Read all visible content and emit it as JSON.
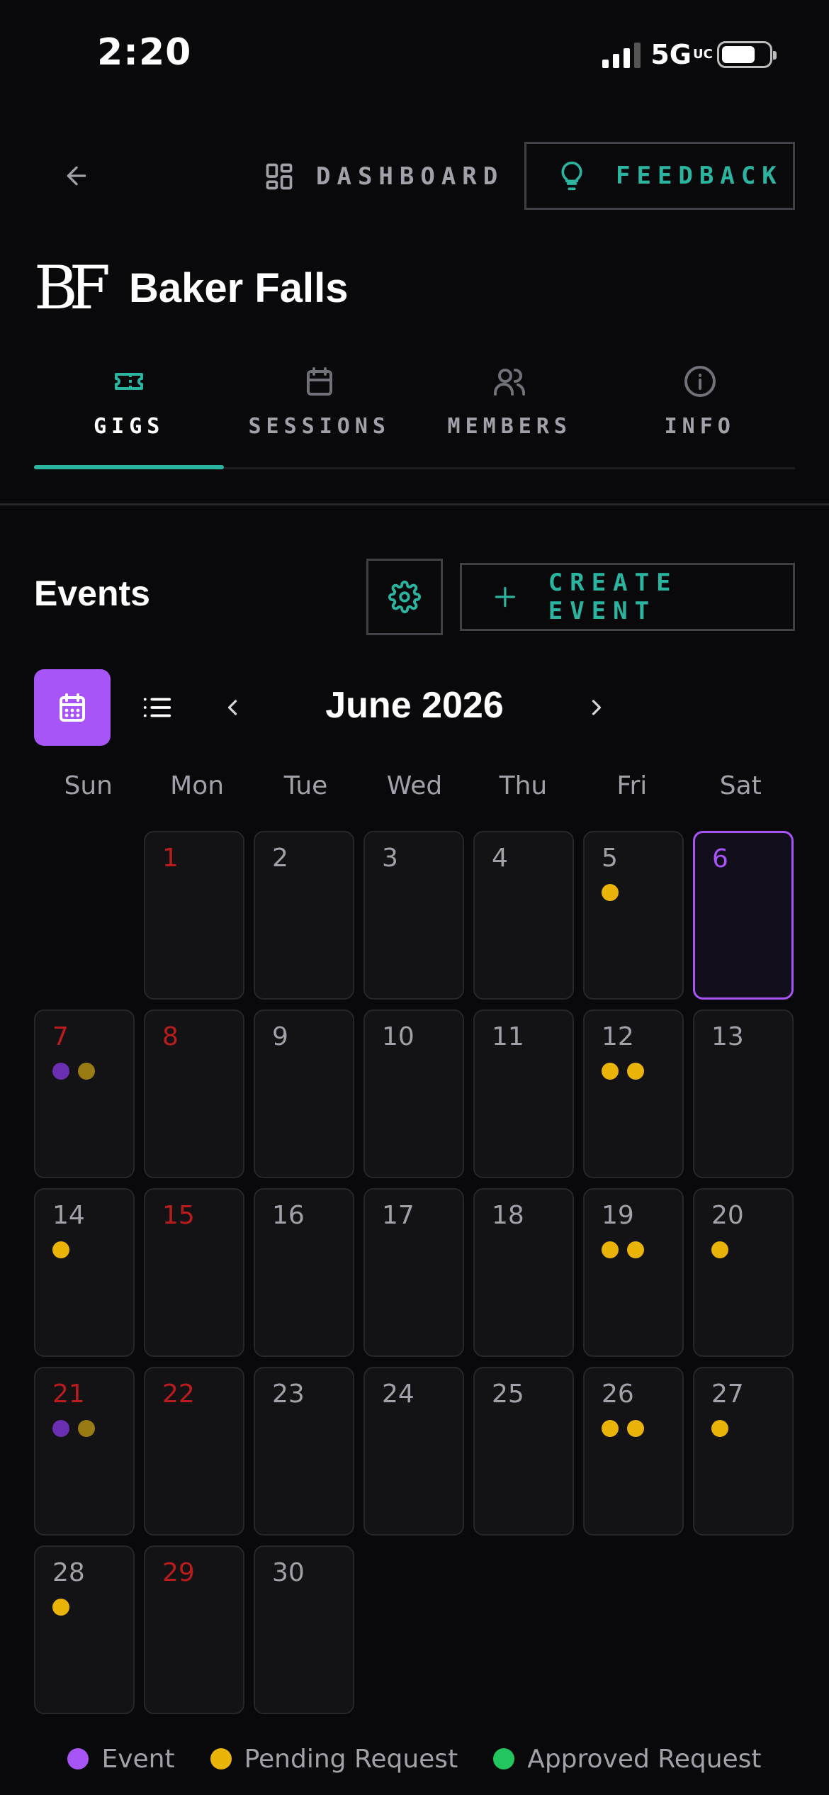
{
  "status_bar": {
    "time": "2:20",
    "network": "5G",
    "network_suffix": "UC"
  },
  "nav": {
    "dashboard_label": "DASHBOARD",
    "feedback_label": "FEEDBACK"
  },
  "band": {
    "logo_text": "BF",
    "name": "Baker Falls"
  },
  "tabs": [
    {
      "label": "GIGS",
      "icon": "ticket-icon",
      "active": true
    },
    {
      "label": "SESSIONS",
      "icon": "calendar-icon",
      "active": false
    },
    {
      "label": "MEMBERS",
      "icon": "users-icon",
      "active": false
    },
    {
      "label": "INFO",
      "icon": "info-icon",
      "active": false
    }
  ],
  "events": {
    "title": "Events",
    "create_label": "CREATE EVENT"
  },
  "calendar": {
    "month_label": "June 2026",
    "weekdays": [
      "Sun",
      "Mon",
      "Tue",
      "Wed",
      "Thu",
      "Fri",
      "Sat"
    ],
    "leading_blanks": 1,
    "today": 6,
    "red_days": [
      1,
      7,
      8,
      15,
      21,
      22,
      29
    ],
    "days": [
      {
        "n": "1",
        "dots": []
      },
      {
        "n": "2",
        "dots": []
      },
      {
        "n": "3",
        "dots": []
      },
      {
        "n": "4",
        "dots": []
      },
      {
        "n": "5",
        "dots": [
          "pending"
        ]
      },
      {
        "n": "6",
        "dots": []
      },
      {
        "n": "7",
        "dots": [
          "event",
          "pending-dim"
        ]
      },
      {
        "n": "8",
        "dots": []
      },
      {
        "n": "9",
        "dots": []
      },
      {
        "n": "10",
        "dots": []
      },
      {
        "n": "11",
        "dots": []
      },
      {
        "n": "12",
        "dots": [
          "pending",
          "pending"
        ]
      },
      {
        "n": "13",
        "dots": []
      },
      {
        "n": "14",
        "dots": [
          "pending"
        ]
      },
      {
        "n": "15",
        "dots": []
      },
      {
        "n": "16",
        "dots": []
      },
      {
        "n": "17",
        "dots": []
      },
      {
        "n": "18",
        "dots": []
      },
      {
        "n": "19",
        "dots": [
          "pending",
          "pending"
        ]
      },
      {
        "n": "20",
        "dots": [
          "pending"
        ]
      },
      {
        "n": "21",
        "dots": [
          "event",
          "pending-dim"
        ]
      },
      {
        "n": "22",
        "dots": []
      },
      {
        "n": "23",
        "dots": []
      },
      {
        "n": "24",
        "dots": []
      },
      {
        "n": "25",
        "dots": []
      },
      {
        "n": "26",
        "dots": [
          "pending",
          "pending"
        ]
      },
      {
        "n": "27",
        "dots": [
          "pending"
        ]
      },
      {
        "n": "28",
        "dots": [
          "pending"
        ]
      },
      {
        "n": "29",
        "dots": []
      },
      {
        "n": "30",
        "dots": []
      }
    ]
  },
  "legend": [
    {
      "label": "Event",
      "color": "#a855f7"
    },
    {
      "label": "Pending Request",
      "color": "#eab308"
    },
    {
      "label": "Approved Request",
      "color": "#22c55e"
    }
  ],
  "colors": {
    "accent_teal": "#2bb5a0",
    "accent_purple": "#a855f7",
    "red_day": "#b91c1c"
  }
}
